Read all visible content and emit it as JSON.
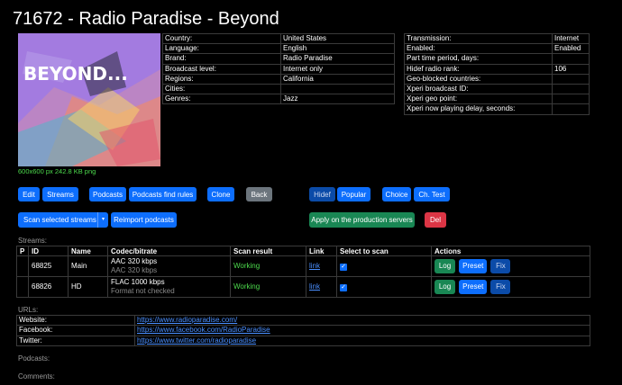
{
  "page": {
    "title": "71672 - Radio Paradise - Beyond"
  },
  "cover": {
    "logo_text": "BEYOND...",
    "caption": "600x600 px 242.8 KB png"
  },
  "info_left": [
    {
      "label": "Country:",
      "value": "United States"
    },
    {
      "label": "Language:",
      "value": "English"
    },
    {
      "label": "Brand:",
      "value": "Radio Paradise"
    },
    {
      "label": "Broadcast level:",
      "value": "Internet only"
    },
    {
      "label": "Regions:",
      "value": "California"
    },
    {
      "label": "Cities:",
      "value": ""
    },
    {
      "label": "Genres:",
      "value": "Jazz"
    }
  ],
  "info_right": [
    {
      "label": "Transmission:",
      "value": "Internet"
    },
    {
      "label": "Enabled:",
      "value": "Enabled"
    },
    {
      "label": "Part time period, days:",
      "value": ""
    },
    {
      "label": "Hidef radio rank:",
      "value": "106"
    },
    {
      "label": "Geo-blocked countries:",
      "value": ""
    },
    {
      "label": "Xperi broadcast ID:",
      "value": ""
    },
    {
      "label": "Xperi geo point:",
      "value": ""
    },
    {
      "label": "Xperi now playing delay, seconds:",
      "value": ""
    }
  ],
  "toolbar": {
    "edit": "Edit",
    "streams": "Streams",
    "podcasts": "Podcasts",
    "podcasts_find_rules": "Podcasts find rules",
    "clone": "Clone",
    "back": "Back",
    "hidef": "Hidef",
    "popular": "Popular",
    "choice": "Choice",
    "ch_test": "Ch. Test",
    "scan_selected": "Scan selected streams",
    "split_caret": "▾",
    "reimport": "Reimport podcasts",
    "apply_production": "Apply on the production servers",
    "del": "Del"
  },
  "streams": {
    "label": "Streams:",
    "headers": [
      "P",
      "ID",
      "Name",
      "Codec/bitrate",
      "Scan result",
      "Link",
      "Select to scan",
      "Actions"
    ],
    "rows": [
      {
        "id": "68825",
        "name": "Main",
        "codec": "AAC 320 kbps",
        "codec_sub": "AAC 320 kbps",
        "scan": "Working",
        "link": "link"
      },
      {
        "id": "68826",
        "name": "HD",
        "codec": "FLAC 1000 kbps",
        "codec_sub": "Format not checked",
        "scan": "Working",
        "link": "link"
      }
    ],
    "actions": {
      "log": "Log",
      "preset": "Preset",
      "fix": "Fix"
    }
  },
  "urls": {
    "label": "URLs:",
    "rows": [
      {
        "label": "Website:",
        "value": "https://www.radioparadise.com/"
      },
      {
        "label": "Facebook:",
        "value": "https://www.facebook.com/RadioParadise"
      },
      {
        "label": "Twitter:",
        "value": "https://www.twitter.com/radioparadise"
      }
    ]
  },
  "podcasts_label": "Podcasts:",
  "comments_label": "Comments:",
  "colors": {
    "primary": "#0d6efd",
    "success": "#198754",
    "danger": "#dc3545",
    "secondary": "#6c757d",
    "status_ok": "#4ddc4d"
  }
}
